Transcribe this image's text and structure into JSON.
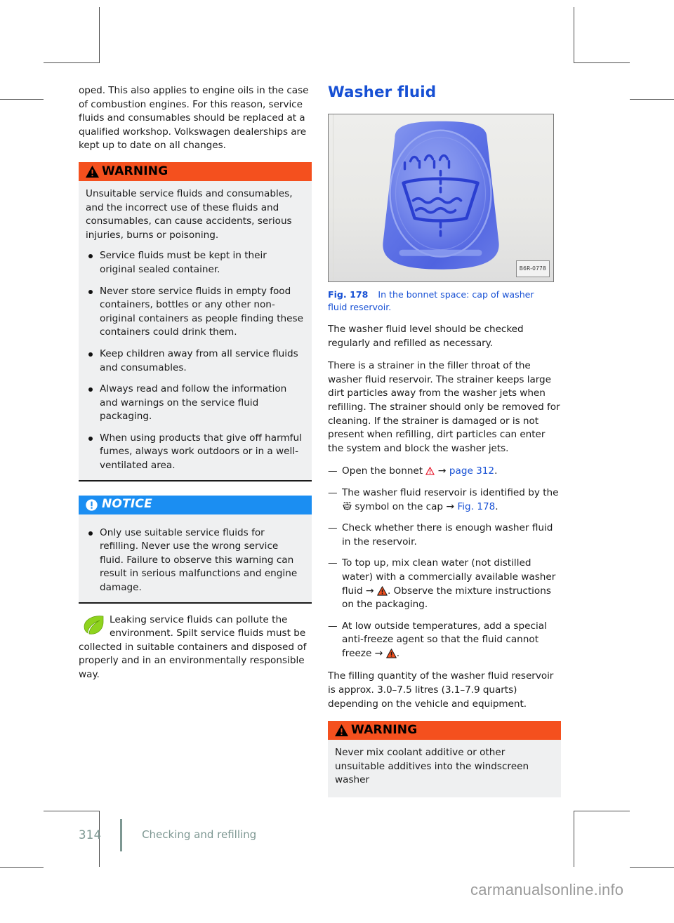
{
  "page": {
    "number": "314",
    "section_title": "Checking and refilling",
    "watermark": "carmanualsonline.info"
  },
  "left_column": {
    "intro_paragraph": "oped. This also applies to engine oils in the case of combustion engines. For this reason, service fluids and consumables should be replaced at a qualified workshop. Volkswagen dealerships are kept up to date on all changes.",
    "warning_box": {
      "title": "WARNING",
      "icon": "warning-triangle-icon",
      "intro": "Unsuitable service fluids and consumables, and the incorrect use of these fluids and consumables, can cause accidents, serious injuries, burns or poisoning.",
      "bullets": [
        "Service fluids must be kept in their original sealed container.",
        "Never store service fluids in empty food containers, bottles or any other non-original containers as people finding these containers could drink them.",
        "Keep children away from all service fluids and consumables.",
        "Always read and follow the information and warnings on the service fluid packaging.",
        "When using products that give off harmful fumes, always work outdoors or in a well-ventilated area."
      ]
    },
    "notice_box": {
      "title": "NOTICE",
      "icon": "notice-exclamation-icon",
      "bullets": [
        "Only use suitable service fluids for refilling. Never use the wrong service fluid. Failure to observe this warning can result in serious malfunctions and engine damage."
      ]
    },
    "eco_note": {
      "icon": "leaf-icon",
      "text": "Leaking service fluids can pollute the environment. Spilt service fluids must be collected in suitable containers and disposed of properly and in an environmentally responsible way."
    },
    "end_marker": "◁"
  },
  "right_column": {
    "heading": "Washer fluid",
    "figure": {
      "image_alt": "blue washer fluid reservoir cap with windscreen washer symbol",
      "corner_label": "B6R-0778",
      "caption_number": "Fig. 178",
      "caption_text": "In the bonnet space: cap of washer fluid reservoir."
    },
    "paragraphs": [
      "The washer fluid level should be checked regularly and refilled as necessary.",
      "There is a strainer in the filler throat of the washer fluid reservoir. The strainer keeps large dirt particles away from the washer jets when refilling. The strainer should only be removed for cleaning. If the strainer is damaged or is not present when refilling, dirt particles can enter the system and block the washer jets."
    ],
    "steps": [
      {
        "text_before": "Open the bonnet",
        "icon": "warning-triangle-red-outline-icon",
        "arrow": "→",
        "link": "page 312",
        "text_after": "."
      },
      {
        "text_before": "The washer fluid reservoir is identified by the",
        "icon": "windscreen-washer-symbol-icon",
        "text_mid": "symbol on the cap",
        "arrow": "→",
        "link": "Fig. 178",
        "text_after": "."
      },
      {
        "text_before": "Check whether there is enough washer fluid in the reservoir.",
        "icon": "",
        "link": "",
        "text_after": ""
      },
      {
        "text_before": "To top up, mix clean water (not distilled water) with a commercially available washer fluid",
        "arrow": "→",
        "icon": "warning-triangle-orange-icon",
        "text_after": ". Observe the mixture instructions on the packaging."
      },
      {
        "text_before": "At low outside temperatures, add a special anti-freeze agent so that the fluid cannot freeze",
        "arrow": "→",
        "icon": "warning-triangle-orange-icon",
        "text_after": "."
      }
    ],
    "capacity_paragraph": "The filling quantity of the washer fluid reservoir is approx. 3.0–7.5 litres (3.1–7.9 quarts) depending on the vehicle and equipment.",
    "warning_box": {
      "title": "WARNING",
      "icon": "warning-triangle-icon",
      "text": "Never mix coolant additive or other unsuitable additives into the windscreen washer"
    }
  },
  "colors": {
    "heading_blue": "#1750d4",
    "warning_orange": "#f4501e",
    "notice_blue": "#1b8ef2",
    "box_grey": "#eff0f1",
    "footer_grey": "#7d9792",
    "leaf_green": "#8fd31e",
    "cap_blue": "#5a6fe0"
  }
}
